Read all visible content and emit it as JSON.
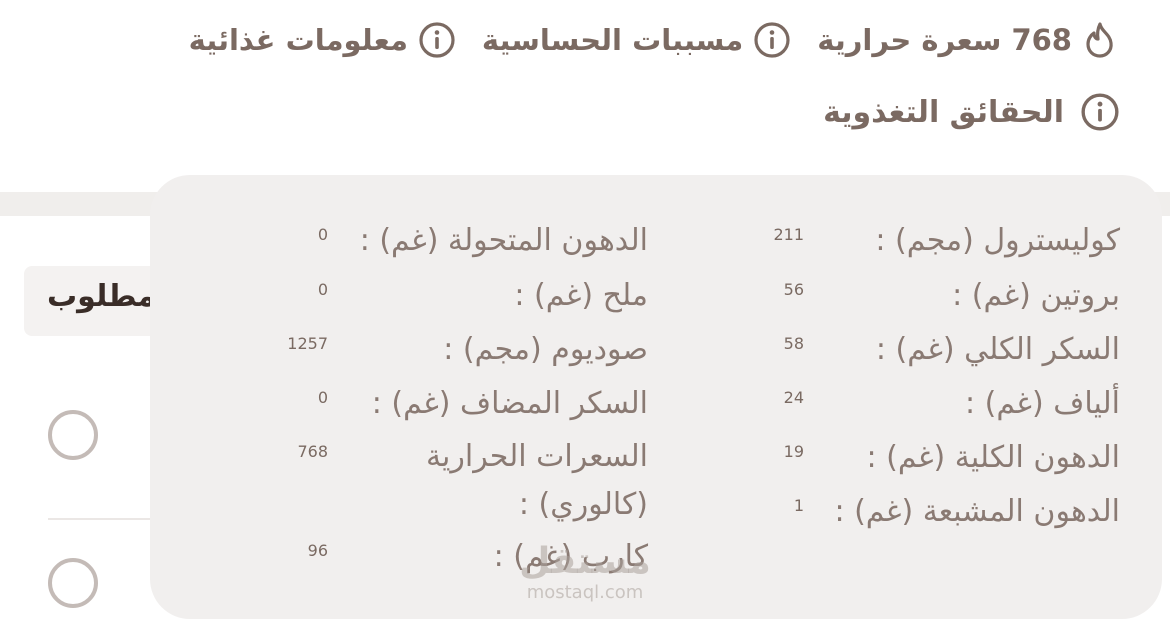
{
  "header": {
    "calories": {
      "value": "768",
      "unit_label": "سعرة حرارية",
      "icon": "flame-icon"
    },
    "allergens": {
      "label": "مسببات الحساسية",
      "icon": "info-icon"
    },
    "nutrition_info": {
      "label": "معلومات غذائية",
      "icon": "info-icon"
    },
    "nutrition_facts": {
      "label": "الحقائق التغذوية",
      "icon": "info-icon"
    }
  },
  "background": {
    "required_label": "مطلوب"
  },
  "facts": {
    "right_column": [
      {
        "label": "كوليسترول (مجم) :",
        "value": "211"
      },
      {
        "label": "بروتين (غم) :",
        "value": "56"
      },
      {
        "label": "السكر الكلي (غم) :",
        "value": "58"
      },
      {
        "label": "ألياف (غم) :",
        "value": "24"
      },
      {
        "label": "الدهون الكلية (غم) :",
        "value": "19"
      },
      {
        "label": "الدهون المشبعة (غم) :",
        "value": "1"
      }
    ],
    "left_column": [
      {
        "label": "الدهون المتحولة (غم) :",
        "value": "0"
      },
      {
        "label": "ملح (غم) :",
        "value": "0"
      },
      {
        "label": "صوديوم (مجم) :",
        "value": "1257"
      },
      {
        "label": "السكر المضاف (غم) :",
        "value": "0"
      },
      {
        "label": "السعرات الحرارية (كالوري) :",
        "value": "768"
      },
      {
        "label": "كارب (غم) :",
        "value": "96"
      }
    ]
  },
  "watermark": {
    "text": "مستقل",
    "domain": "mostaql.com"
  },
  "colors": {
    "text": "#7b6a62",
    "panel_bg": "#f1efee",
    "radio_border": "#c4bbb7"
  }
}
